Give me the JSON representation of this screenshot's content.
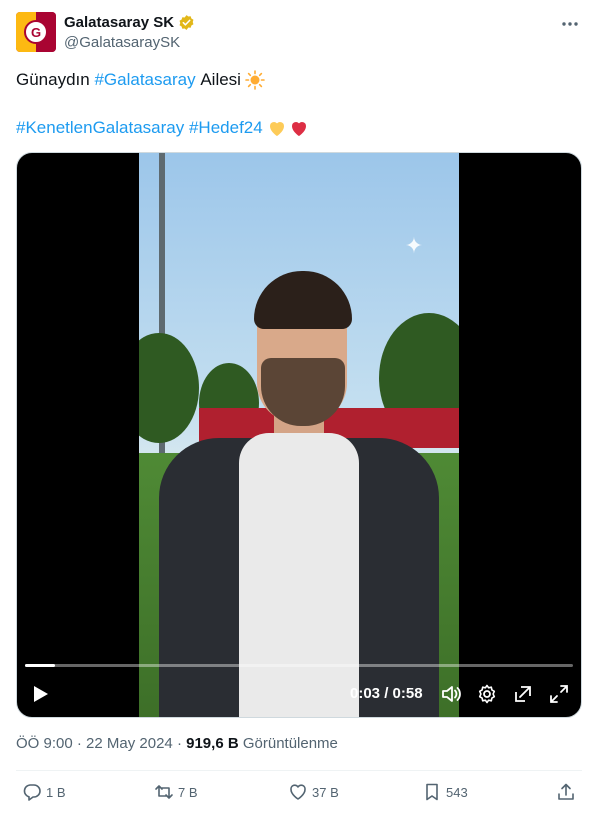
{
  "account": {
    "display_name": "Galatasaray SK",
    "handle": "@GalatasaraySK"
  },
  "tweet": {
    "line1_prefix": "Günaydın",
    "line1_hashtag": "#Galatasaray",
    "line1_suffix": "Ailesi",
    "line2_hashtag1": "#KenetlenGalatasaray",
    "line2_hashtag2": "#Hedef24",
    "emojis": [
      "sun-emoji",
      "yellow-heart-emoji",
      "red-heart-emoji"
    ]
  },
  "video": {
    "current_time": "0:03",
    "duration": "0:58",
    "time_display": "0:03 / 0:58",
    "progress_fraction": 0.055
  },
  "meta": {
    "time": "ÖÖ 9:00",
    "separator": "·",
    "date": "22 May 2024",
    "views_count": "919,6 B",
    "views_label": "Görüntülenme"
  },
  "actions": {
    "replies": "1 B",
    "retweets": "7 B",
    "likes": "37 B",
    "bookmarks": "543"
  },
  "colors": {
    "hashtag": "#1d9bf0",
    "brand_red": "#a90432",
    "brand_gold": "#fdb912"
  }
}
